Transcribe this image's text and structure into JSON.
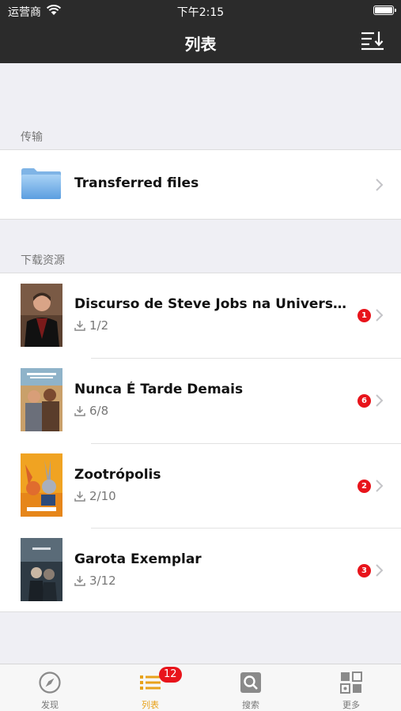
{
  "status_bar": {
    "carrier": "运营商",
    "time": "下午2:15"
  },
  "nav": {
    "title": "列表",
    "sort_icon": "sort-descending-icon"
  },
  "sections": {
    "transfer": {
      "label": "传输",
      "item": {
        "title": "Transferred files",
        "icon": "folder-icon"
      }
    },
    "downloads": {
      "label": "下载资源",
      "items": [
        {
          "title": "Discurso de Steve Jobs na Universid...",
          "progress": "1/2",
          "badge": "1",
          "poster": "steve-jobs-poster"
        },
        {
          "title": "Nunca É Tarde Demais",
          "progress": "6/8",
          "badge": "6",
          "poster": "bucket-list-poster"
        },
        {
          "title": "Zootrópolis",
          "progress": "2/10",
          "badge": "2",
          "poster": "zootopia-poster"
        },
        {
          "title": "Garota Exemplar",
          "progress": "3/12",
          "badge": "3",
          "poster": "gone-girl-poster"
        }
      ]
    }
  },
  "tabbar": {
    "active_color": "#e8a21b",
    "badge_color": "#e8141b",
    "tabs": [
      {
        "label": "发现",
        "icon": "compass-icon"
      },
      {
        "label": "列表",
        "icon": "list-icon",
        "badge": "12",
        "active": true
      },
      {
        "label": "搜索",
        "icon": "search-icon"
      },
      {
        "label": "更多",
        "icon": "grid-more-icon"
      }
    ]
  }
}
